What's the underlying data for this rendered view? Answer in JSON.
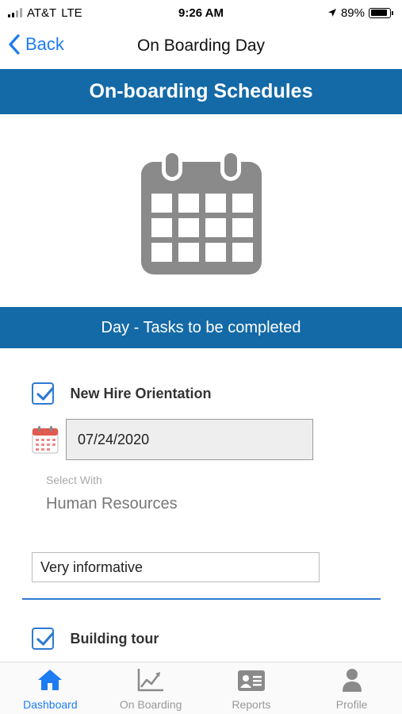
{
  "status_bar": {
    "carrier": "AT&T",
    "network": "LTE",
    "time": "9:26 AM",
    "battery_percent": "89%",
    "battery_level": 0.89
  },
  "nav": {
    "back_label": "Back",
    "title": "On Boarding Day"
  },
  "banner": {
    "title": "On-boarding Schedules",
    "icon": "calendar-icon"
  },
  "section": {
    "header": "Day - Tasks to be completed"
  },
  "tasks": [
    {
      "label": "New Hire Orientation",
      "checked": true,
      "date": "07/24/2020",
      "select_caption": "Select With",
      "select_value": "Human Resources",
      "comment": "Very informative"
    },
    {
      "label": "Building tour",
      "checked": true
    }
  ],
  "tab_bar": {
    "active": "Dashboard",
    "tabs": [
      {
        "label": "Dashboard",
        "icon": "home-icon"
      },
      {
        "label": "On Boarding",
        "icon": "chart-icon"
      },
      {
        "label": "Reports",
        "icon": "id-card-icon"
      },
      {
        "label": "Profile",
        "icon": "person-icon"
      }
    ]
  },
  "colors": {
    "primary": "#146aa6",
    "accent": "#1d7cf2",
    "checkbox": "#2e7ad1",
    "icon_gray": "#8a8a8a"
  }
}
